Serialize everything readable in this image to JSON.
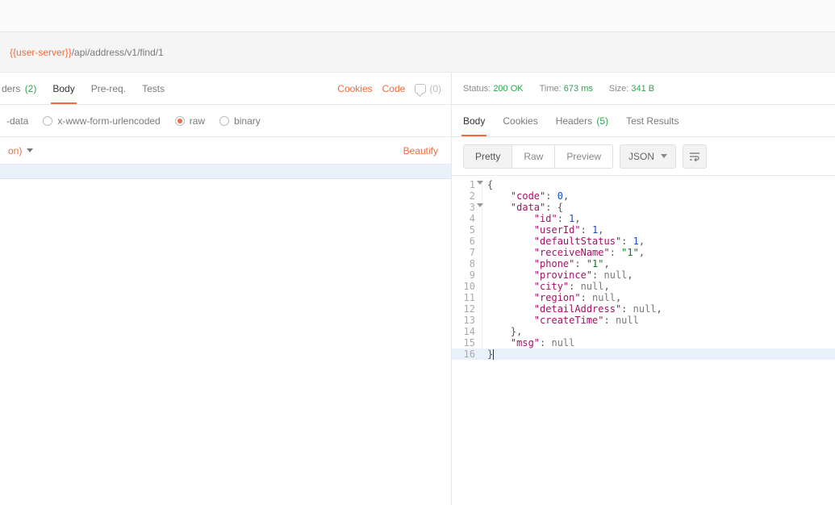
{
  "url": {
    "variable": "{{user-server}}",
    "path": "/api/address/v1/find/1"
  },
  "req_tabs": {
    "headers_partial": "ders",
    "headers_count": "(2)",
    "body": "Body",
    "prereq": "Pre-req.",
    "tests": "Tests"
  },
  "actions": {
    "cookies": "Cookies",
    "code": "Code",
    "comments_count": "(0)"
  },
  "body_types": {
    "formdata_partial": "-data",
    "xwww": "x-www-form-urlencoded",
    "raw": "raw",
    "binary": "binary"
  },
  "subrow": {
    "dropdown_partial": "on)",
    "beautify": "Beautify"
  },
  "status": {
    "status_label": "Status:",
    "status_value": "200 OK",
    "time_label": "Time:",
    "time_value": "673 ms",
    "size_label": "Size:",
    "size_value": "341 B"
  },
  "resp_tabs": {
    "body": "Body",
    "cookies": "Cookies",
    "headers": "Headers",
    "headers_count": "(5)",
    "tests": "Test Results"
  },
  "toolbar": {
    "pretty": "Pretty",
    "raw": "Raw",
    "preview": "Preview",
    "format": "JSON"
  },
  "json_lines": [
    {
      "n": 1,
      "fold": true,
      "indent": 0,
      "tokens": [
        {
          "t": "punc",
          "v": "{"
        }
      ]
    },
    {
      "n": 2,
      "fold": false,
      "indent": 1,
      "tokens": [
        {
          "t": "key",
          "v": "\"code\""
        },
        {
          "t": "punc",
          "v": ": "
        },
        {
          "t": "num",
          "v": "0"
        },
        {
          "t": "punc",
          "v": ","
        }
      ]
    },
    {
      "n": 3,
      "fold": true,
      "indent": 1,
      "tokens": [
        {
          "t": "key",
          "v": "\"data\""
        },
        {
          "t": "punc",
          "v": ": "
        },
        {
          "t": "punc",
          "v": "{"
        }
      ]
    },
    {
      "n": 4,
      "fold": false,
      "indent": 2,
      "tokens": [
        {
          "t": "key",
          "v": "\"id\""
        },
        {
          "t": "punc",
          "v": ": "
        },
        {
          "t": "num",
          "v": "1"
        },
        {
          "t": "punc",
          "v": ","
        }
      ]
    },
    {
      "n": 5,
      "fold": false,
      "indent": 2,
      "tokens": [
        {
          "t": "key",
          "v": "\"userId\""
        },
        {
          "t": "punc",
          "v": ": "
        },
        {
          "t": "num",
          "v": "1"
        },
        {
          "t": "punc",
          "v": ","
        }
      ]
    },
    {
      "n": 6,
      "fold": false,
      "indent": 2,
      "tokens": [
        {
          "t": "key",
          "v": "\"defaultStatus\""
        },
        {
          "t": "punc",
          "v": ": "
        },
        {
          "t": "num",
          "v": "1"
        },
        {
          "t": "punc",
          "v": ","
        }
      ]
    },
    {
      "n": 7,
      "fold": false,
      "indent": 2,
      "tokens": [
        {
          "t": "key",
          "v": "\"receiveName\""
        },
        {
          "t": "punc",
          "v": ": "
        },
        {
          "t": "str",
          "v": "\"1\""
        },
        {
          "t": "punc",
          "v": ","
        }
      ]
    },
    {
      "n": 8,
      "fold": false,
      "indent": 2,
      "tokens": [
        {
          "t": "key",
          "v": "\"phone\""
        },
        {
          "t": "punc",
          "v": ": "
        },
        {
          "t": "str",
          "v": "\"1\""
        },
        {
          "t": "punc",
          "v": ","
        }
      ]
    },
    {
      "n": 9,
      "fold": false,
      "indent": 2,
      "tokens": [
        {
          "t": "key",
          "v": "\"province\""
        },
        {
          "t": "punc",
          "v": ": "
        },
        {
          "t": "null",
          "v": "null"
        },
        {
          "t": "punc",
          "v": ","
        }
      ]
    },
    {
      "n": 10,
      "fold": false,
      "indent": 2,
      "tokens": [
        {
          "t": "key",
          "v": "\"city\""
        },
        {
          "t": "punc",
          "v": ": "
        },
        {
          "t": "null",
          "v": "null"
        },
        {
          "t": "punc",
          "v": ","
        }
      ]
    },
    {
      "n": 11,
      "fold": false,
      "indent": 2,
      "tokens": [
        {
          "t": "key",
          "v": "\"region\""
        },
        {
          "t": "punc",
          "v": ": "
        },
        {
          "t": "null",
          "v": "null"
        },
        {
          "t": "punc",
          "v": ","
        }
      ]
    },
    {
      "n": 12,
      "fold": false,
      "indent": 2,
      "tokens": [
        {
          "t": "key",
          "v": "\"detailAddress\""
        },
        {
          "t": "punc",
          "v": ": "
        },
        {
          "t": "null",
          "v": "null"
        },
        {
          "t": "punc",
          "v": ","
        }
      ]
    },
    {
      "n": 13,
      "fold": false,
      "indent": 2,
      "tokens": [
        {
          "t": "key",
          "v": "\"createTime\""
        },
        {
          "t": "punc",
          "v": ": "
        },
        {
          "t": "null",
          "v": "null"
        }
      ]
    },
    {
      "n": 14,
      "fold": false,
      "indent": 1,
      "tokens": [
        {
          "t": "punc",
          "v": "},"
        }
      ]
    },
    {
      "n": 15,
      "fold": false,
      "indent": 1,
      "tokens": [
        {
          "t": "key",
          "v": "\"msg\""
        },
        {
          "t": "punc",
          "v": ": "
        },
        {
          "t": "null",
          "v": "null"
        }
      ]
    },
    {
      "n": 16,
      "fold": false,
      "indent": 0,
      "hl": true,
      "cursor": true,
      "tokens": [
        {
          "t": "punc",
          "v": "}"
        }
      ]
    }
  ]
}
